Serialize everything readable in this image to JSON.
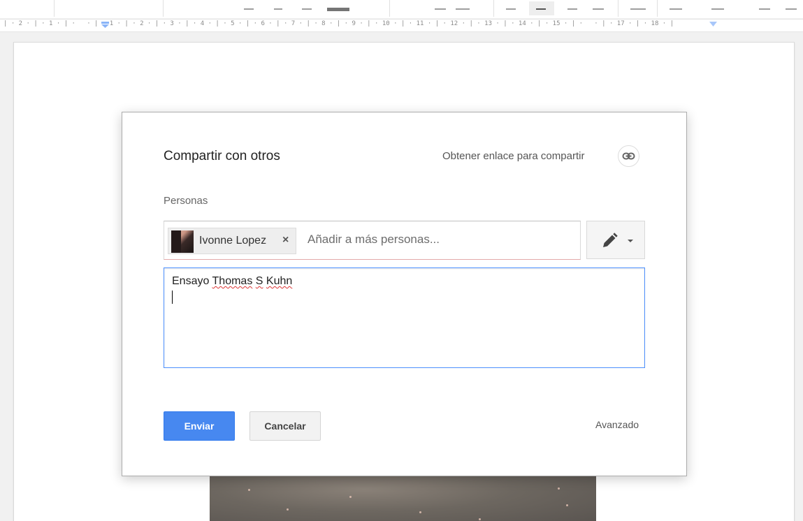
{
  "ruler": {
    "text": "| · 2 · | · 1 · | ·   · | · 1 · | · 2 · | · 3 · | · 4 · | · 5 · | · 6 · | · 7 · | · 8 · | · 9 · | · 10 · | · 11 · | · 12 · | · 13 · | · 14 · | · 15 · | ·   · | · 17 · | · 18 · |"
  },
  "dialog": {
    "title": "Compartir con otros",
    "get_link_label": "Obtener enlace para compartir",
    "people_label": "Personas",
    "recipient": {
      "name": "Ivonne Lopez",
      "remove_label": "×"
    },
    "add_people_placeholder": "Añadir a más personas...",
    "permission_icon": "pencil-icon",
    "message": {
      "word1": "Ensayo",
      "word2": "Thomas",
      "word3": "S",
      "word4": "Kuhn"
    },
    "send_label": "Enviar",
    "cancel_label": "Cancelar",
    "advanced_label": "Avanzado"
  },
  "colors": {
    "primary_button": "#4788f0",
    "focus_border": "#4d90fe",
    "spellcheck": "#dd3333"
  }
}
